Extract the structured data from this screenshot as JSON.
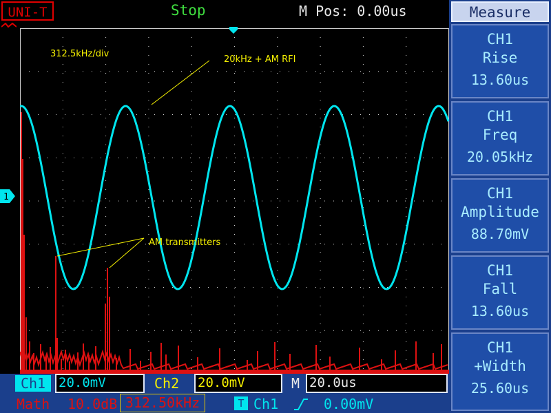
{
  "header": {
    "brand": "UNI-T",
    "run_state": "Stop",
    "mpos_label": "M Pos:",
    "mpos_value": "0.00us"
  },
  "screen": {
    "annotations": {
      "scale": "312.5kHz/div",
      "rfi": "20kHz + AM RFI",
      "transmitters": "AM transmitters"
    },
    "channel_marker": "1"
  },
  "measure": {
    "title": "Measure",
    "items": [
      {
        "ch": "CH1",
        "name": "Rise",
        "value": "13.60us"
      },
      {
        "ch": "CH1",
        "name": "Freq",
        "value": "20.05kHz"
      },
      {
        "ch": "CH1",
        "name": "Amplitude",
        "value": "88.70mV"
      },
      {
        "ch": "CH1",
        "name": "Fall",
        "value": "13.60us"
      },
      {
        "ch": "CH1",
        "name": "+Width",
        "value": "25.60us"
      }
    ]
  },
  "bottom": {
    "ch1_label": "Ch1",
    "ch1_scale": "20.0mV",
    "ch2_label": "Ch2",
    "ch2_scale": "20.0mV",
    "m_label": "M",
    "timebase": "20.0us",
    "math_label": "Math",
    "math_db": "10.0dB",
    "math_freq": "312.50kHz",
    "trig_icon": "T",
    "trig_source": "Ch1",
    "trig_level": "0.00mV"
  },
  "colors": {
    "ch1": "#00e5ee",
    "math": "#dd1111",
    "annotation": "#f5f000",
    "panel": "#1b3f8c",
    "grid": "#cfcfcf"
  }
}
